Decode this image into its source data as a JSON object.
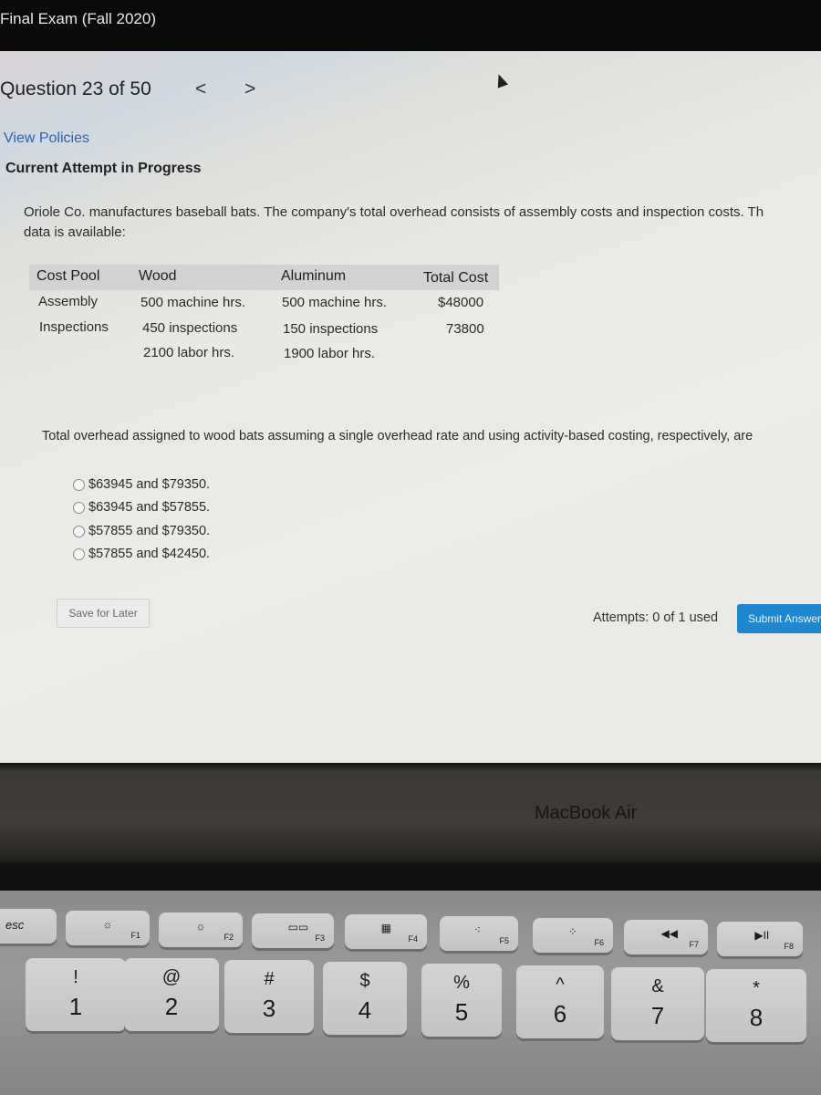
{
  "exam": {
    "title": "Final Exam (Fall 2020)"
  },
  "nav": {
    "question_label": "Question 23 of 50",
    "prev_glyph": "<",
    "next_glyph": ">"
  },
  "links": {
    "view_policies": "View Policies"
  },
  "status": {
    "attempt": "Current Attempt in Progress"
  },
  "question": {
    "line1": "Oriole Co. manufactures baseball bats. The company's total overhead consists of assembly costs and inspection costs. Th",
    "line2": "data is available:",
    "prompt": "Total overhead assigned to wood bats assuming a single overhead rate and using activity-based costing, respectively, are"
  },
  "cost_table": {
    "headers": [
      "Cost Pool",
      "Wood",
      "Aluminum",
      "Total Cost"
    ],
    "rows": [
      [
        "Assembly",
        "500 machine hrs.",
        "500 machine hrs.",
        "$48000"
      ],
      [
        "Inspections",
        "450 inspections",
        "150 inspections",
        "73800"
      ],
      [
        "",
        "2100 labor hrs.",
        "1900 labor hrs.",
        ""
      ]
    ]
  },
  "options": [
    {
      "label": "$63945 and $79350.",
      "selected": false
    },
    {
      "label": "$63945 and $57855.",
      "selected": false
    },
    {
      "label": "$57855 and $79350.",
      "selected": false
    },
    {
      "label": "$57855 and $42450.",
      "selected": false
    }
  ],
  "footer": {
    "save_label": "Save for Later",
    "attempts_text": "Attempts: 0 of 1 used",
    "submit_label": "Submit Answer",
    "submit_color": "#1f86d0"
  },
  "laptop": {
    "brand": "MacBook Air"
  },
  "keyboard": {
    "fkeys": [
      {
        "label": "esc",
        "icon": ""
      },
      {
        "label": "F1",
        "icon": "brightness-down-icon",
        "glyph": "☼"
      },
      {
        "label": "F2",
        "icon": "brightness-up-icon",
        "glyph": "☼"
      },
      {
        "label": "F3",
        "icon": "mission-control-icon",
        "glyph": "▭▭"
      },
      {
        "label": "F4",
        "icon": "launchpad-icon",
        "glyph": "▦"
      },
      {
        "label": "F5",
        "icon": "keyboard-light-down-icon",
        "glyph": "⁖"
      },
      {
        "label": "F6",
        "icon": "keyboard-light-up-icon",
        "glyph": "⁘"
      },
      {
        "label": "F7",
        "icon": "rewind-icon",
        "glyph": "◀◀"
      },
      {
        "label": "F8",
        "icon": "play-pause-icon",
        "glyph": "▶II"
      }
    ],
    "number_keys": [
      {
        "shift": "!",
        "main": "1"
      },
      {
        "shift": "@",
        "main": "2"
      },
      {
        "shift": "#",
        "main": "3"
      },
      {
        "shift": "$",
        "main": "4"
      },
      {
        "shift": "%",
        "main": "5"
      },
      {
        "shift": "^",
        "main": "6"
      },
      {
        "shift": "&",
        "main": "7"
      },
      {
        "shift": "*",
        "main": "8"
      }
    ]
  }
}
